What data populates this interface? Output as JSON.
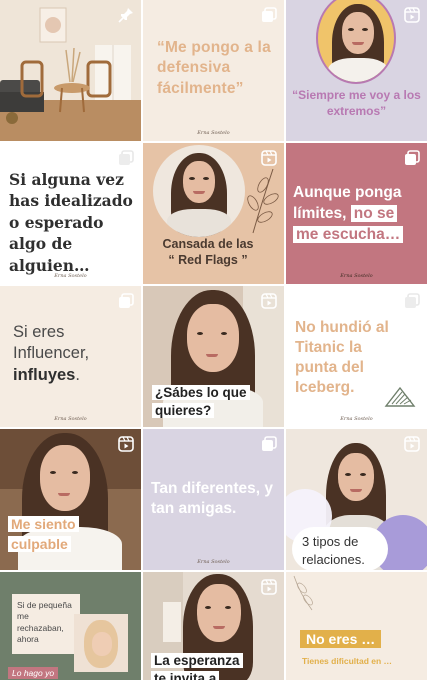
{
  "colors": {
    "beige": "#f5ece2",
    "tan": "#e6c3a6",
    "lavender": "#d9d4e2",
    "rose": "#c27680",
    "green": "#6f7f6b",
    "text_tan": "#e2b48c",
    "text_lavender": "#b879b2",
    "text_dark": "#3a3a3a",
    "white": "#ffffff"
  },
  "posts": {
    "p1": {
      "type": "pinned",
      "badge_icon": "pin-icon"
    },
    "p2": {
      "type": "carousel",
      "quote": "“Me pongo a la defensiva fácilmente”",
      "signature": "Erna Sostelo"
    },
    "p3": {
      "type": "reel",
      "caption": "“Siempre me voy a los extremos”"
    },
    "p4": {
      "type": "carousel",
      "text": "Si alguna vez has idealizado o esperado algo de alguien…",
      "signature": "Erna Sostelo"
    },
    "p5": {
      "type": "reel",
      "title_line1": "Cansada de las",
      "title_line2": "“ Red Flags ”"
    },
    "p6": {
      "type": "carousel",
      "text_plain": "Aunque ponga límites,",
      "text_highlight_1": "no se",
      "text_highlight_2": "me escucha…",
      "signature": "Erna Sostelo"
    },
    "p7": {
      "type": "carousel",
      "text_plain": "Si eres Influencer,",
      "text_bold": "influyes",
      "text_end": ".",
      "signature": "Erna Sostelo"
    },
    "p8": {
      "type": "reel",
      "caption_line1": "¿Sábes lo que",
      "caption_line2": "quieres?"
    },
    "p9": {
      "type": "carousel",
      "text": "No hundió al Titanic la punta del Iceberg.",
      "signature": "Erna Sostelo"
    },
    "p10": {
      "type": "reel",
      "caption_line1": "Me siento",
      "caption_line2": "culpable"
    },
    "p11": {
      "type": "carousel",
      "text": "Tan diferentes, y tan amigas.",
      "signature": "Erna Sostelo"
    },
    "p12": {
      "type": "reel",
      "caption_line1": "3 tipos de",
      "caption_line2": "relaciones."
    },
    "p13": {
      "type": "carousel",
      "card_text": "Si de pequeña me rechazaban, ahora",
      "footer_text": "Lo hago yo"
    },
    "p14": {
      "type": "reel",
      "caption_line1": "La esperanza",
      "caption_line2": "te invita a"
    },
    "p15": {
      "type": "carousel",
      "title": "No eres …",
      "subtitle": "Tienes dificultad en …"
    }
  }
}
